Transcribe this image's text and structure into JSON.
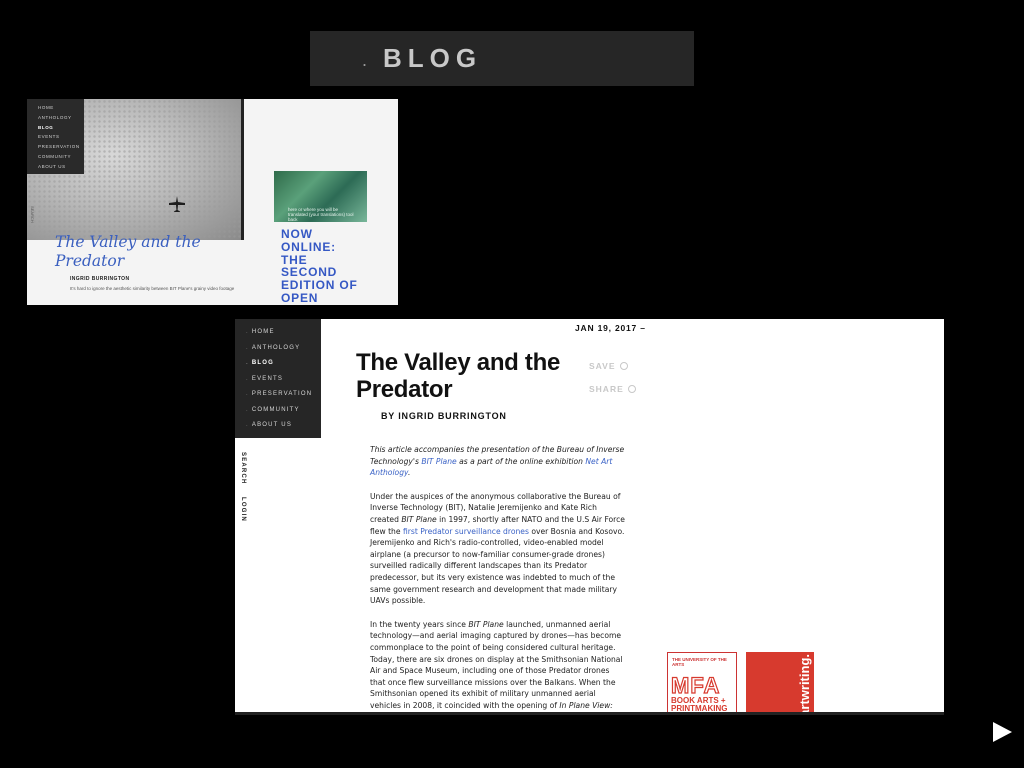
{
  "banner": {
    "dot": ".",
    "title": "BLOG"
  },
  "thumbnail": {
    "nav": [
      "HOME",
      "ANTHOLOGY",
      "BLOG",
      "EVENTS",
      "PRESERVATION",
      "COMMUNITY",
      "ABOUT US"
    ],
    "active_nav": "BLOG",
    "side_text": "SEARCH",
    "headline": "The Valley and the Predator",
    "byline": "INGRID BURRINGTON",
    "snippet": "It's hard to ignore the aesthetic similarity between BIT Plane's grainy video footage",
    "promo_caption": "here or where you will be translated (your translations) tool back",
    "callout": "NOW ONLINE: THE SECOND EDITION OF OPEN"
  },
  "article_page": {
    "nav": [
      {
        "label": "HOME"
      },
      {
        "label": "ANTHOLOGY"
      },
      {
        "label": "BLOG",
        "active": true
      },
      {
        "label": "EVENTS"
      },
      {
        "label": "PRESERVATION"
      },
      {
        "label": "COMMUNITY"
      },
      {
        "label": "ABOUT US"
      }
    ],
    "side_links": [
      "SEARCH",
      "LOGIN"
    ],
    "date": "JAN 19, 2017 –",
    "title": "The Valley and the Predator",
    "byline": "BY INGRID BURRINGTON",
    "actions": {
      "save": "SAVE",
      "share": "SHARE"
    },
    "intro": {
      "t1": "This article accompanies the presentation of the Bureau of Inverse Technology's ",
      "link1": "BIT Plane",
      "t2": " as a part of the online exhibition ",
      "link2": "Net Art Anthology",
      "t3": "."
    },
    "para1": {
      "t1": "Under the auspices of the anonymous collaborative the Bureau of Inverse Technology (BIT), Natalie Jeremijenko and Kate Rich created ",
      "em1": "BIT Plane",
      "t2": " in 1997, shortly after NATO and the U.S Air Force flew the ",
      "link1": "first Predator surveillance drones",
      "t3": " over Bosnia and Kosovo. Jeremijenko and Rich's radio-controlled, video-enabled model airplane (a precursor to now-familiar consumer-grade drones) surveilled radically different landscapes than its Predator predecessor, but its very existence was indebted to much of the same government research and development that made military UAVs possible."
    },
    "para2": {
      "t1": "In the twenty years since ",
      "em1": "BIT Plane",
      "t2": " launched, unmanned aerial technology—and aerial imaging captured by drones—has become commonplace to the point of being considered cultural heritage. Today, there are six drones on display at the Smithsonian National Air and Space Museum, including one of those Predator drones that once flew surveillance missions over the Balkans. When the Smithsonian opened its exhibit of military unmanned aerial vehicles in 2008, it coincided with the opening of ",
      "em2": "In Plane View:"
    },
    "ad1": {
      "org": "THE UNIVERSITY OF THE ARTS",
      "big": "MFA",
      "sub1": "BOOK ARTS +",
      "sub2": "PRINTMAKING"
    },
    "ad2": {
      "text": "artwriting."
    }
  },
  "next_button": {
    "icon": "play-next-icon",
    "color": "#ffffff"
  }
}
